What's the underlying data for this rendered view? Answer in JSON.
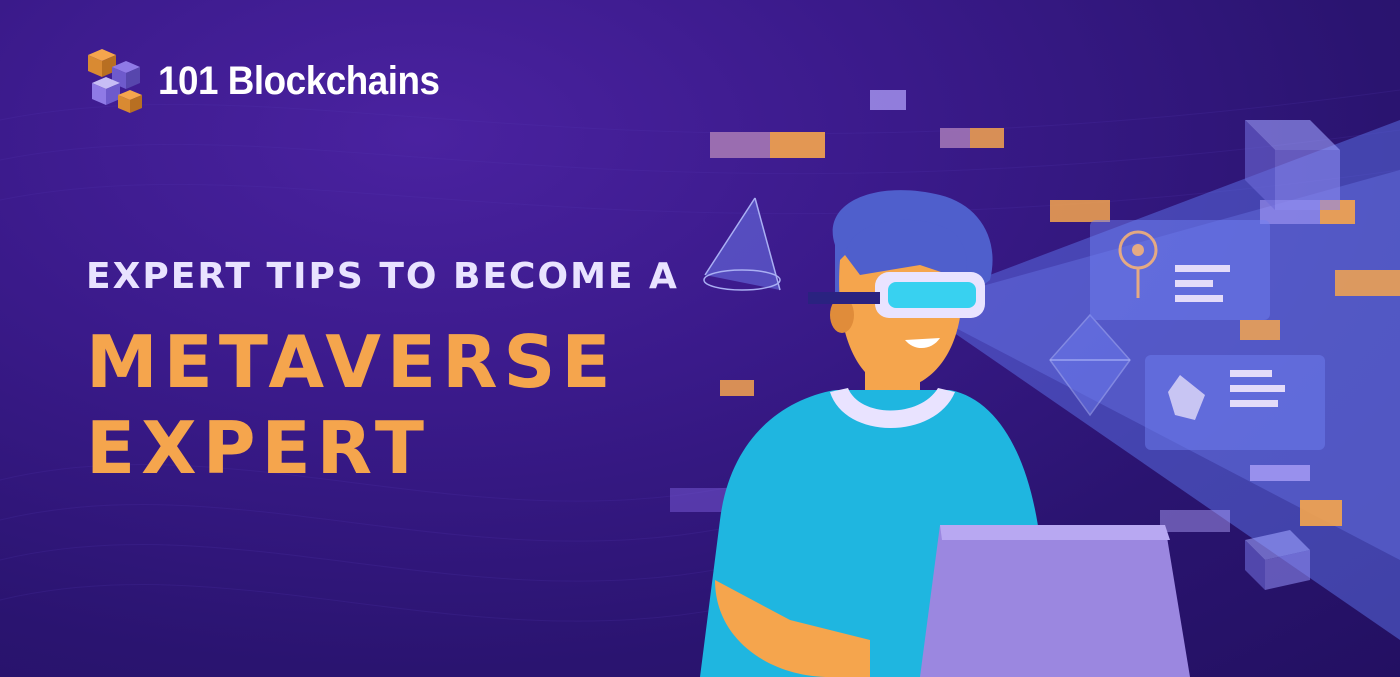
{
  "brand": {
    "name": "101 Blockchains"
  },
  "headline": {
    "line1": "EXPERT TIPS TO BECOME A",
    "line2": "METAVERSE",
    "line3": "EXPERT"
  },
  "colors": {
    "background": "#2f1680",
    "accent": "#f5a54d",
    "light_text": "#e9e3ff",
    "shirt": "#1fb6e0",
    "laptop": "#9b87e0",
    "beam": "#5a6be0"
  },
  "icons": [
    "logo-cubes-icon",
    "cone-icon",
    "cube-icon",
    "diamond-icon",
    "location-pin-icon",
    "vr-headset-icon"
  ]
}
